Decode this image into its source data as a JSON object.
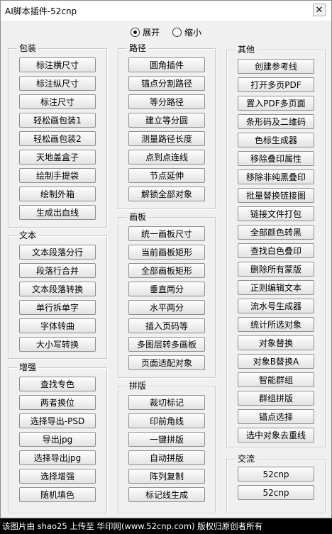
{
  "window": {
    "title": "AI脚本插件-52cnp",
    "close_label": "✕"
  },
  "mode": {
    "expand_label": "展开",
    "collapse_label": "缩小",
    "selected": "expand"
  },
  "groups": {
    "package": {
      "label": "包装",
      "buttons": [
        "标注横尺寸",
        "标注纵尺寸",
        "标注尺寸",
        "轻松画包装1",
        "轻松画包装2",
        "天地盖盒子",
        "绘制手提袋",
        "绘制外箱",
        "生成出血线"
      ]
    },
    "text": {
      "label": "文本",
      "buttons": [
        "文本段落分行",
        "段落行合并",
        "文本段落转换",
        "单行拆单字",
        "字体转曲",
        "大小写转换"
      ]
    },
    "enhance": {
      "label": "增强",
      "buttons": [
        "查找专色",
        "两者换位",
        "选择导出-PSD",
        "导出jpg",
        "选择导出jpg",
        "选择增强",
        "随机填色"
      ]
    },
    "path": {
      "label": "路径",
      "buttons": [
        "圆角插件",
        "锚点分割路径",
        "等分路径",
        "建立等分圆",
        "测量路径长度",
        "点到点连线",
        "节点延伸",
        "解锁全部对象"
      ]
    },
    "artboard": {
      "label": "画板",
      "buttons": [
        "统一画板尺寸",
        "当前画板矩形",
        "全部画板矩形",
        "垂直两分",
        "水平两分",
        "插入页码等",
        "多图层转多画板",
        "页面适配对象"
      ]
    },
    "imposition": {
      "label": "拼版",
      "buttons": [
        "裁切标记",
        "印前角线",
        "一键拼版",
        "自动拼版",
        "阵列复制",
        "标记线生成"
      ]
    },
    "other": {
      "label": "其他",
      "buttons": [
        "创建参考线",
        "打开多页PDF",
        "置入PDF多页面",
        "条形码及二维码",
        "色标生成器",
        "移除叠印属性",
        "移除非纯黑叠印",
        "批量替换链接图",
        "链接文件打包",
        "全部颜色转黑",
        "查找白色叠印",
        "删除所有蒙版",
        "正则编辑文本",
        "流水号生成器",
        "统计所选对象",
        "对象替换",
        "对象B替换A",
        "智能群组",
        "群组拼版",
        "锚点选择",
        "选中对象去重线"
      ]
    },
    "exchange": {
      "label": "交流",
      "buttons": [
        "52cnp",
        "52cnp"
      ]
    }
  },
  "footer": {
    "text": "该图片由 shao25 上传至 华印网(www.52cnp.com) 版权归原创者所有"
  }
}
